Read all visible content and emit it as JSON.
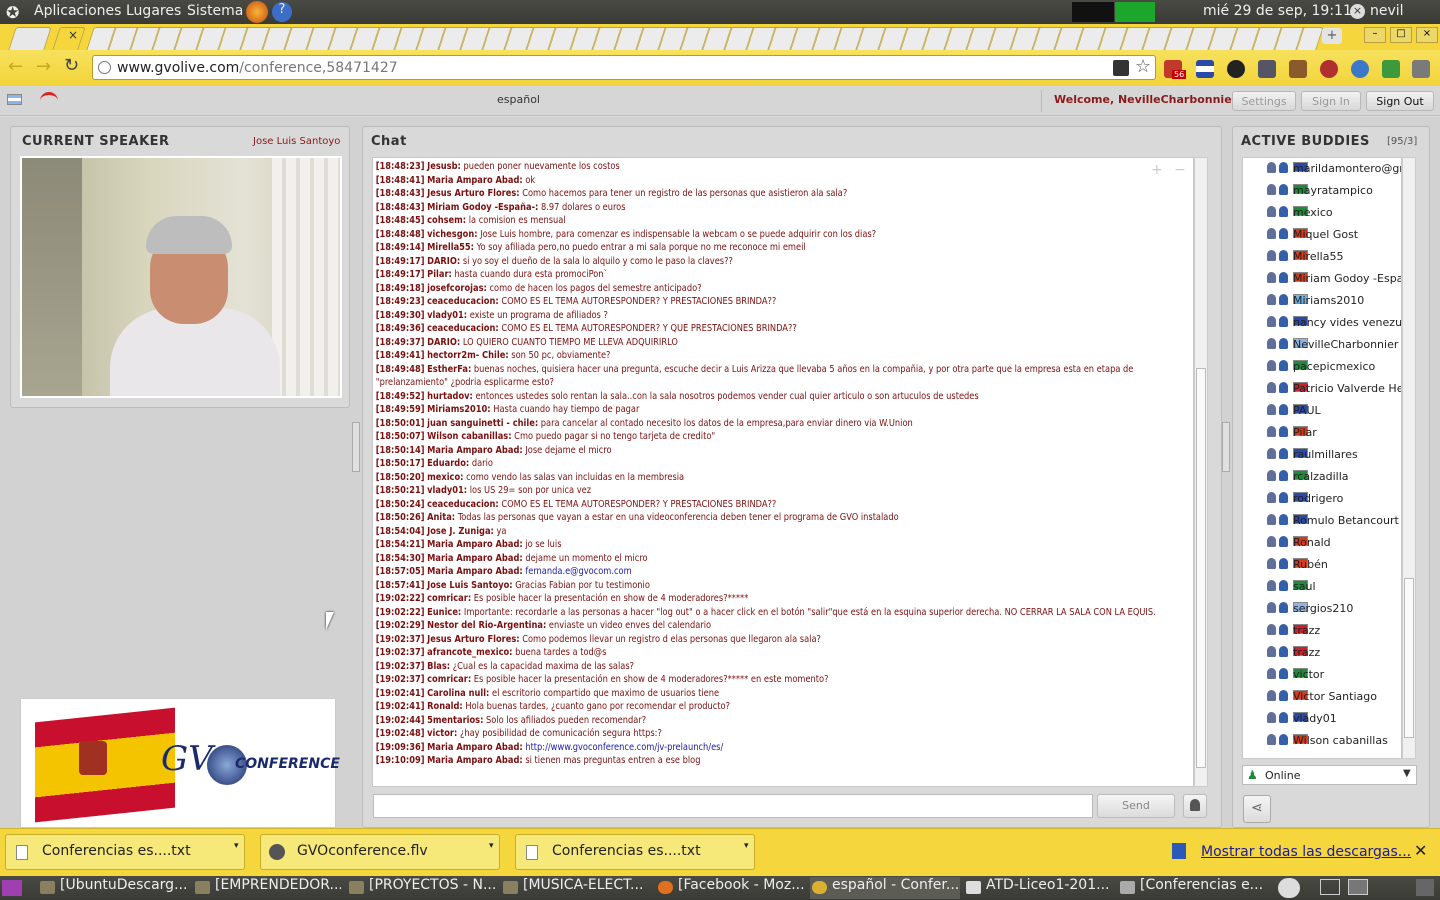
{
  "top_panel": {
    "menus": [
      "Aplicaciones",
      "Lugares",
      "Sistema"
    ],
    "clock": "mié 29 de sep, 19:11",
    "user": "nevil"
  },
  "browser": {
    "url_domain": "www.gvolive.com",
    "url_path": "/conference,58471427",
    "ext_badge": "56"
  },
  "app_header": {
    "language": "español",
    "welcome": "Welcome, NevilleCharbonnier",
    "settings": "Settings",
    "sign_in": "Sign In",
    "sign_out": "Sign Out"
  },
  "speaker_panel": {
    "title": "CURRENT SPEAKER",
    "speaker_name": "Jose Luis  Santoyo"
  },
  "chat": {
    "title": "Chat",
    "send_label": "Send",
    "input_value": "",
    "messages": [
      {
        "t": "[18:48:23]",
        "u": "Jesusb:",
        "m": "pueden poner nuevamente los costos"
      },
      {
        "t": "[18:48:41]",
        "u": "Maria Amparo  Abad:",
        "m": "ok"
      },
      {
        "t": "[18:48:43]",
        "u": "Jesus Arturo Flores:",
        "m": "Como hacemos para tener un registro de las personas que asistieron ala sala?"
      },
      {
        "t": "[18:48:43]",
        "u": "Miriam Godoy -España-:",
        "m": "8.97 dolares o euros"
      },
      {
        "t": "[18:48:45]",
        "u": "cohsem:",
        "m": "la comision es mensual"
      },
      {
        "t": "[18:48:48]",
        "u": "vichesgon:",
        "m": "Jose Luis hombre, para comenzar es indispensable la webcam o se puede adquirir con los dias?"
      },
      {
        "t": "[18:49:14]",
        "u": "Mirella55:",
        "m": "Yo soy afiliada pero,no puedo entrar a mi sala porque no me reconoce mi emeil"
      },
      {
        "t": "[18:49:17]",
        "u": "DARIO:",
        "m": "si yo soy el dueño de la sala lo alquilo y como le paso la claves??"
      },
      {
        "t": "[18:49:17]",
        "u": "Pilar:",
        "m": "hasta cuando dura esta promociPon`"
      },
      {
        "t": "[18:49:18]",
        "u": "josefcorojas:",
        "m": "como de hacen los pagos del semestre anticipado?"
      },
      {
        "t": "[18:49:23]",
        "u": "ceaceducacion:",
        "m": "COMO ES EL TEMA AUTORESPONDER? Y PRESTACIONES BRINDA??"
      },
      {
        "t": "[18:49:30]",
        "u": "vlady01:",
        "m": "existe un programa de afiliados ?"
      },
      {
        "t": "[18:49:36]",
        "u": "ceaceducacion:",
        "m": "COMO ES EL TEMA AUTORESPONDER? Y QUE PRESTACIONES BRINDA??"
      },
      {
        "t": "[18:49:37]",
        "u": "DARIO:",
        "m": "LO QUIERO CUANTO TIEMPO ME LLEVA ADQUIRIRLO"
      },
      {
        "t": "[18:49:41]",
        "u": "hectorr2m- Chile:",
        "m": "son 50 pc, obviamente?"
      },
      {
        "t": "[18:49:48]",
        "u": "EstherFa:",
        "m": "buenas noches, quisiera hacer una pregunta, escuche decir a Luis Arizza que llevaba 5 años en la compañia, y por otra parte que la empresa esta en etapa de \"prelanzamiento\" ¿podria esplicarme esto?",
        "wrap": true
      },
      {
        "t": "[18:49:52]",
        "u": "hurtadov:",
        "m": "entonces ustedes solo rentan la sala..con la sala nosotros podemos vender cual quier articulo o son artuculos de ustedes"
      },
      {
        "t": "[18:49:59]",
        "u": "Miriams2010:",
        "m": "Hasta cuando hay tiempo de pagar"
      },
      {
        "t": "[18:50:01]",
        "u": "juan sanguinetti - chile:",
        "m": "para cancelar al contado necesito los datos de la empresa,para enviar dinero via W.Union"
      },
      {
        "t": "[18:50:07]",
        "u": "Wilson cabanillas:",
        "m": "Cmo puedo pagar si no tengo tarjeta de credito\""
      },
      {
        "t": "[18:50:14]",
        "u": "Maria Amparo  Abad:",
        "m": "Jose dejame el micro"
      },
      {
        "t": "[18:50:17]",
        "u": "Eduardo:",
        "m": "dario"
      },
      {
        "t": "[18:50:20]",
        "u": "mexico:",
        "m": "como vendo las salas van incluidas en la membresia"
      },
      {
        "t": "[18:50:21]",
        "u": "vlady01:",
        "m": "los US 29= son por unica vez"
      },
      {
        "t": "[18:50:24]",
        "u": "ceaceducacion:",
        "m": "COMO ES EL TEMA AUTORESPONDER? Y PRESTACIONES BRINDA??"
      },
      {
        "t": "[18:50:26]",
        "u": "Anita:",
        "m": "Todas las personas que vayan a estar en una videoconferencia deben tener el programa de GVO instalado"
      },
      {
        "t": "[18:54:04]",
        "u": "Jose J.  Zuniga:",
        "m": "ya"
      },
      {
        "t": "[18:54:21]",
        "u": "Maria Amparo  Abad:",
        "m": "jo se luis"
      },
      {
        "t": "[18:54:30]",
        "u": "Maria Amparo  Abad:",
        "m": "dejame un momento el micro"
      },
      {
        "t": "[18:57:05]",
        "u": "Maria Amparo  Abad:",
        "m": "",
        "link": "fernanda.e@gvocom.com"
      },
      {
        "t": "[18:57:41]",
        "u": "Jose Luis  Santoyo:",
        "m": "Gracias Fabian por tu testimonio"
      },
      {
        "t": "[19:02:22]",
        "u": "comricar:",
        "m": "Es posible hacer la presentación en show de 4 moderadores?*****"
      },
      {
        "t": "[19:02:22]",
        "u": "Eunice:",
        "m": "Importante: recordarle a las personas a hacer \"log out\" o a hacer click en el botón \"salir\"que está en la esquina superior derecha. NO CERRAR LA SALA CON LA EQUIS.",
        "wrap": true
      },
      {
        "t": "[19:02:29]",
        "u": "Nestor del Rio-Argentina:",
        "m": "enviaste un video enves del calendario"
      },
      {
        "t": "[19:02:37]",
        "u": "Jesus Arturo Flores:",
        "m": "Como podemos llevar un registro d elas personas que llegaron ala sala?"
      },
      {
        "t": "[19:02:37]",
        "u": "afrancote_mexico:",
        "m": "buena tardes a tod@s"
      },
      {
        "t": "[19:02:37]",
        "u": "Blas:",
        "m": "¿Cual es la capacidad maxima de las salas?"
      },
      {
        "t": "[19:02:37]",
        "u": "comricar:",
        "m": "Es posible hacer la presentación en show de 4 moderadores?*****  en este momento?"
      },
      {
        "t": "[19:02:41]",
        "u": "Carolina null:",
        "m": "el escritorio compartido que maximo de usuarios tiene"
      },
      {
        "t": "[19:02:41]",
        "u": "Ronald:",
        "m": "Hola buenas tardes, ¿cuanto gano por recomendar el producto?"
      },
      {
        "t": "[19:02:44]",
        "u": "5mentarios:",
        "m": "Solo los afiliados pueden recomendar?"
      },
      {
        "t": "[19:02:48]",
        "u": "victor:",
        "m": "¿hay posibilidad de comunicación segura https:?"
      },
      {
        "t": "[19:09:36]",
        "u": "Maria Amparo  Abad:",
        "m": "",
        "link": "http://www.gvoconference.com/jv-prelaunch/es/"
      },
      {
        "t": "[19:10:09]",
        "u": "Maria Amparo  Abad:",
        "m": "si tienen mas preguntas entren a ese blog"
      }
    ]
  },
  "buddies_panel": {
    "title": "ACTIVE BUDDIES",
    "count": "[95/3]",
    "status": "Online",
    "buddies": [
      {
        "name": "marildamontero@gma",
        "flag": "#2b4aa8"
      },
      {
        "name": "mayratampico",
        "flag": "#1e8a3a"
      },
      {
        "name": "mexico",
        "flag": "#1e8a3a"
      },
      {
        "name": "Miquel Gost",
        "flag": "#d43a1c"
      },
      {
        "name": "Mirella55",
        "flag": "#d43a1c"
      },
      {
        "name": "Miriam Godoy -España",
        "flag": "#d43a1c"
      },
      {
        "name": "Miriams2010",
        "flag": "#6fb3e8"
      },
      {
        "name": "nancy vides venezuel",
        "flag": "#2b4aa8"
      },
      {
        "name": "NevilleCharbonnier",
        "flag": "#8fb4e0"
      },
      {
        "name": "pacepicmexico",
        "flag": "#1e8a3a"
      },
      {
        "name": "Patricio Valverde Hev",
        "flag": "#c8222c"
      },
      {
        "name": "PAUL",
        "flag": "#2b4aa8"
      },
      {
        "name": "Pilar",
        "flag": "#d43a1c"
      },
      {
        "name": "raulmillares",
        "flag": "#2b4aa8"
      },
      {
        "name": "rcalzadilla",
        "flag": "#1e8a3a"
      },
      {
        "name": "rodrigero",
        "flag": "#2b4aa8"
      },
      {
        "name": "Romulo Betancourt V",
        "flag": "#2b4aa8"
      },
      {
        "name": "Ronald",
        "flag": "#d43a1c"
      },
      {
        "name": "Rubén",
        "flag": "#d43a1c"
      },
      {
        "name": "saul",
        "flag": "#1e8a3a"
      },
      {
        "name": "sergios210",
        "flag": "#8fb4e0"
      },
      {
        "name": "trazz",
        "flag": "#c8222c"
      },
      {
        "name": "trazz",
        "flag": "#c8222c"
      },
      {
        "name": "victor",
        "flag": "#1e8a3a"
      },
      {
        "name": "Victor Santiago",
        "flag": "#d43a1c"
      },
      {
        "name": "vlady01",
        "flag": "#2b4aa8"
      },
      {
        "name": "Wilson cabanillas",
        "flag": "#d43a1c"
      }
    ]
  },
  "logo": {
    "text_gvo": "GV",
    "text_conf": "CONFERENCE"
  },
  "downloads": {
    "items": [
      "Conferencias es....txt",
      "GVOconference.flv",
      "Conferencias es....txt"
    ],
    "show_all": "Mostrar todas las descargas..."
  },
  "taskbar": {
    "items": [
      "[UbuntuDescarg...",
      "[EMPRENDEDOR...",
      "[PROYECTOS - N...",
      "[MUSICA-ELECT...",
      "[Facebook - Moz...",
      "español - Confer...",
      "ATD-Liceo1-201...",
      "[Conferencias e..."
    ]
  }
}
